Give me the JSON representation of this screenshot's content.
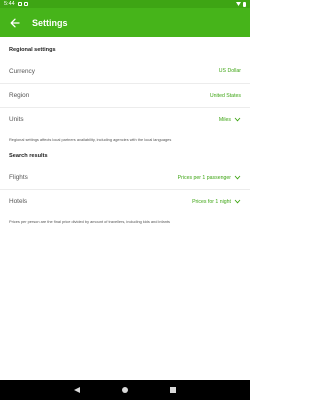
{
  "status_bar": {
    "time": "5:44"
  },
  "app_bar": {
    "title": "Settings"
  },
  "regional": {
    "header": "Regional settings",
    "currency": {
      "label": "Currency",
      "value": "US Dollar"
    },
    "region": {
      "label": "Region",
      "value": "United States"
    },
    "units": {
      "label": "Units",
      "value": "Miles"
    },
    "note": "Regional settings affects local partners availability, including agencies with the local languages"
  },
  "search_results": {
    "header": "Search results",
    "flights": {
      "label": "Flights",
      "value": "Prices per 1 passenger"
    },
    "hotels": {
      "label": "Hotels",
      "value": "Prices for 1 night"
    },
    "note": "Prices per person are the final price divided by amount of travellers, including kids and infants"
  },
  "colors": {
    "accent": "#3ea514",
    "app_bar": "#46b41a"
  }
}
